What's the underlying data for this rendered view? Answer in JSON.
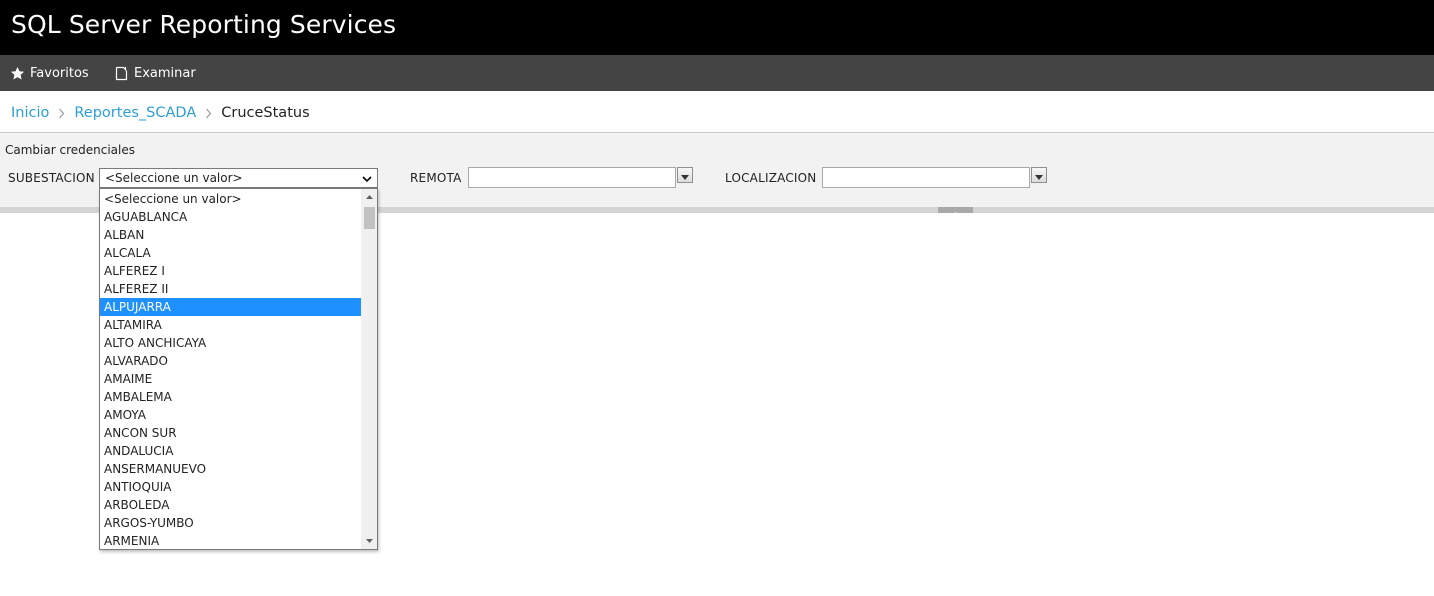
{
  "app": {
    "title": "SQL Server Reporting Services"
  },
  "nav": {
    "favorites_label": "Favoritos",
    "favorites_icon": "star-icon",
    "browse_label": "Examinar",
    "browse_icon": "document-icon"
  },
  "breadcrumb": {
    "items": [
      "Inicio",
      "Reportes_SCADA"
    ],
    "current": "CruceStatus"
  },
  "params": {
    "change_credentials": "Cambiar credenciales",
    "subestacion_label": "SUBESTACION",
    "subestacion_value": "<Seleccione un valor>",
    "remota_label": "REMOTA",
    "remota_value": "",
    "localizacion_label": "LOCALIZACION",
    "localizacion_value": ""
  },
  "dropdown": {
    "selected": "ALPUJARRA",
    "options": [
      "<Seleccione un valor>",
      "AGUABLANCA",
      "ALBAN",
      "ALCALA",
      "ALFEREZ I",
      "ALFEREZ II",
      "ALPUJARRA",
      "ALTAMIRA",
      "ALTO ANCHICAYA",
      "ALVARADO",
      "AMAIME",
      "AMBALEMA",
      "AMOYA",
      "ANCON SUR",
      "ANDALUCIA",
      "ANSERMANUEVO",
      "ANTIOQUIA",
      "ARBOLEDA",
      "ARGOS-YUMBO",
      "ARMENIA"
    ]
  },
  "colors": {
    "titlebar": "#000000",
    "navbar": "#444444",
    "link": "#2c9fd8",
    "selection": "#1e90ff"
  }
}
